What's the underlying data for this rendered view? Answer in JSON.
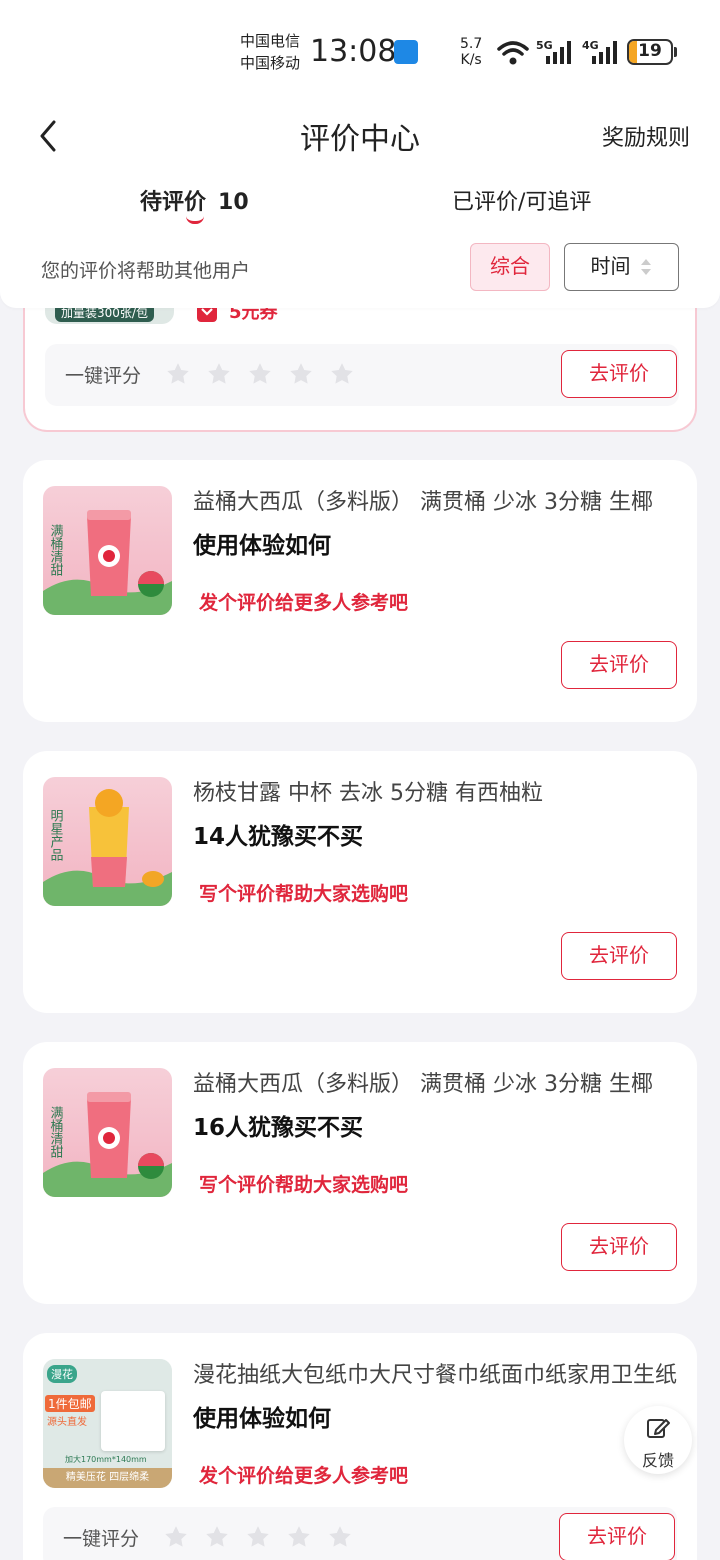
{
  "status_bar": {
    "carrier1": "中国电信",
    "carrier2": "中国移动",
    "time": "13:08",
    "speed_value": "5.7",
    "speed_unit": "K/s",
    "net1": "5G",
    "net2": "4G",
    "battery": "19",
    "battery_level": 0.19
  },
  "header": {
    "back_icon": "back-arrow-icon",
    "title": "评价中心",
    "rules": "奖励规则",
    "tab_pending": "待评价",
    "tab_pending_count": "10",
    "tab_done": "已评价/可追评",
    "hint": "您的评价将帮助其他用户",
    "sort_general": "综合",
    "sort_time": "时间"
  },
  "partial_card": {
    "pack_label": "加量装300张/包",
    "coupon": "5元券",
    "rating_label": "一键评分",
    "button": "去评价"
  },
  "cards": [
    {
      "title": "益桶大西瓜（多料版） 满贯桶 少冰 3分糖 生椰",
      "subtitle": "使用体验如何",
      "promo": "发个评价给更多人参考吧",
      "button": "去评价",
      "thumb_text": "满桶清甜"
    },
    {
      "title": "杨枝甘露 中杯 去冰 5分糖 有西柚粒",
      "subtitle": "14人犹豫买不买",
      "promo": "写个评价帮助大家选购吧",
      "button": "去评价",
      "thumb_text": "明星产品"
    },
    {
      "title": "益桶大西瓜（多料版） 满贯桶 少冰 3分糖 生椰",
      "subtitle": "16人犹豫买不买",
      "promo": "写个评价帮助大家选购吧",
      "button": "去评价",
      "thumb_text": "满桶清甜"
    },
    {
      "title": "漫花抽纸大包纸巾大尺寸餐巾纸面巾纸家用卫生纸",
      "subtitle": "使用体验如何",
      "promo": "发个评价给更多人参考吧",
      "button": "去评价",
      "rating_label": "一键评分",
      "thumb_brand": "漫花",
      "thumb_banner": "1件包邮",
      "thumb_sub": "源头直发",
      "thumb_spec": "加大170mm*140mm",
      "thumb_footer": "精美压花 四层绵柔"
    }
  ],
  "feedback": {
    "label": "反馈",
    "icon": "edit-icon"
  },
  "colors": {
    "accent": "#e0263c",
    "background": "#f3f3f7",
    "card": "#ffffff"
  }
}
